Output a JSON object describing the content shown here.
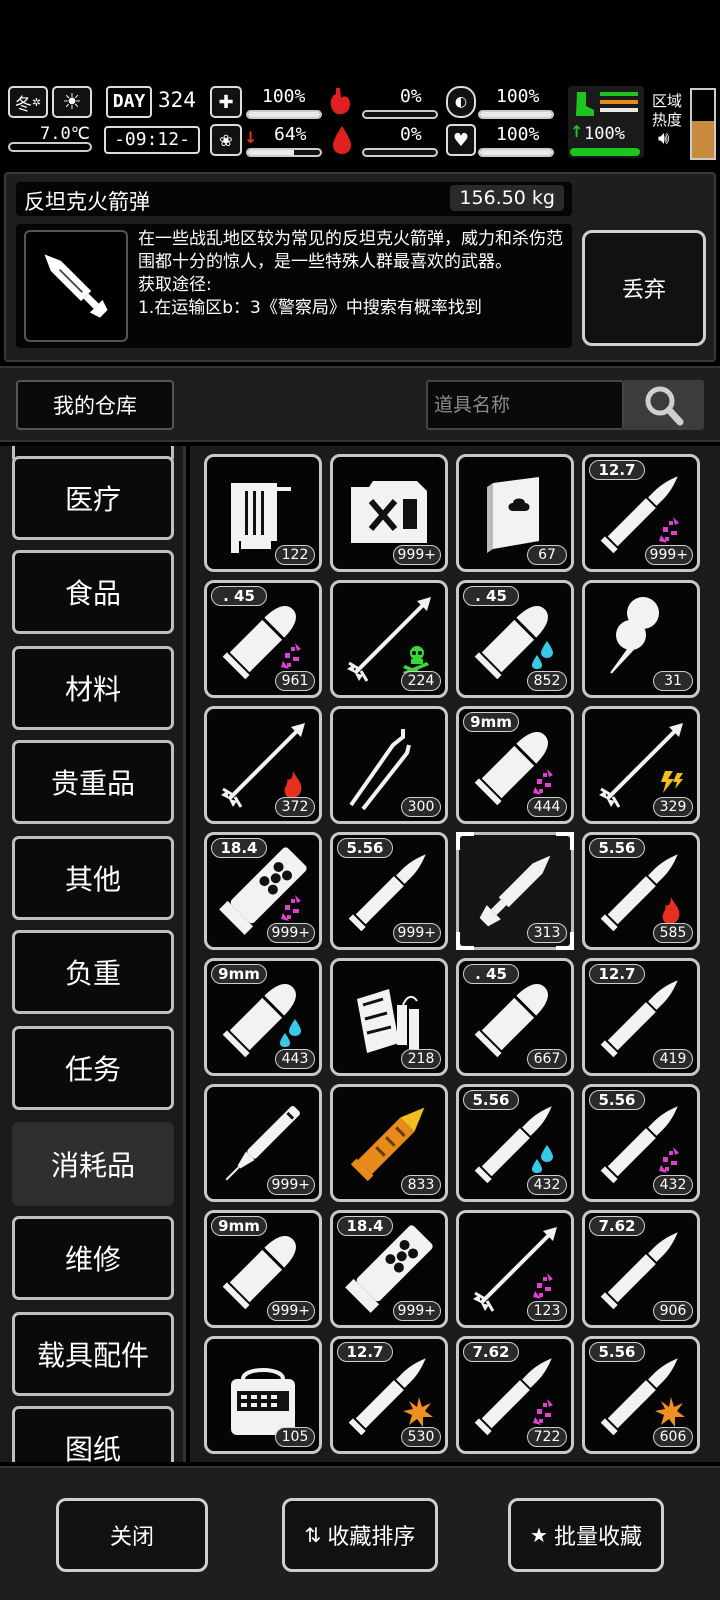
{
  "hud": {
    "season": "冬",
    "temperature": "7.0℃",
    "day_label": "DAY",
    "day_number": "324",
    "time": "-09:12-",
    "stats": [
      {
        "name": "health",
        "value": "100%",
        "fill": 100
      },
      {
        "name": "hunger",
        "value": "0%",
        "fill": 0
      },
      {
        "name": "stamina",
        "value": "100%",
        "fill": 100
      },
      {
        "name": "mental",
        "value": "64%",
        "fill": 64
      },
      {
        "name": "blood",
        "value": "0%",
        "fill": 0
      },
      {
        "name": "heart",
        "value": "100%",
        "fill": 100
      }
    ],
    "weight_pct": "100%",
    "region_label": "区域热度"
  },
  "item_info": {
    "name": "反坦克火箭弹",
    "weight": "156.50 kg",
    "description": "在一些战乱地区较为常见的反坦克火箭弹，威力和杀伤范围都十分的惊人，是一些特殊人群最喜欢的武器。",
    "source_label": "获取途径:",
    "source_partial": "1.在运输区b：3《警察局》中搜索有概率找到",
    "discard_label": "丢弃"
  },
  "warehouse": {
    "title": "我的仓库",
    "search_placeholder": "道具名称"
  },
  "categories": [
    "医疗",
    "食品",
    "材料",
    "贵重品",
    "其他",
    "负重",
    "任务",
    "消耗品",
    "维修",
    "载具配件",
    "图纸"
  ],
  "active_category": "消耗品",
  "items": [
    {
      "icon": "graphics-card-icon",
      "count": "122",
      "caliber": "",
      "effect": ""
    },
    {
      "icon": "fuel-can-icon",
      "count": "999+",
      "caliber": "",
      "effect": ""
    },
    {
      "icon": "book-icon",
      "count": "67",
      "caliber": "",
      "effect": ""
    },
    {
      "icon": "rifle-bullet-icon",
      "count": "999+",
      "caliber": "12.7",
      "effect": "pink-burst"
    },
    {
      "icon": "pistol-bullet-icon",
      "count": "961",
      "caliber": ". 45",
      "effect": "pink-burst"
    },
    {
      "icon": "arrow-icon",
      "count": "224",
      "caliber": "",
      "effect": "poison"
    },
    {
      "icon": "pistol-bullet-icon",
      "count": "852",
      "caliber": ". 45",
      "effect": "water"
    },
    {
      "icon": "balloon-icon",
      "count": "31",
      "caliber": "",
      "effect": ""
    },
    {
      "icon": "arrow-icon",
      "count": "372",
      "caliber": "",
      "effect": "fire"
    },
    {
      "icon": "lockpick-icon",
      "count": "300",
      "caliber": "",
      "effect": ""
    },
    {
      "icon": "pistol-bullet-icon",
      "count": "444",
      "caliber": "9mm",
      "effect": "pink-burst"
    },
    {
      "icon": "arrow-icon",
      "count": "329",
      "caliber": "",
      "effect": "lightning"
    },
    {
      "icon": "shotgun-shell-icon",
      "count": "999+",
      "caliber": "18.4",
      "effect": "pink-burst"
    },
    {
      "icon": "rifle-bullet-icon",
      "count": "999+",
      "caliber": "5.56",
      "effect": ""
    },
    {
      "icon": "rocket-icon",
      "count": "313",
      "caliber": "",
      "effect": ""
    },
    {
      "icon": "rifle-bullet-icon",
      "count": "585",
      "caliber": "5.56",
      "effect": "fire"
    },
    {
      "icon": "pistol-bullet-icon",
      "count": "443",
      "caliber": "9mm",
      "effect": "water"
    },
    {
      "icon": "explosive-pack-icon",
      "count": "218",
      "caliber": "",
      "effect": ""
    },
    {
      "icon": "pistol-bullet-icon",
      "count": "667",
      "caliber": ". 45",
      "effect": ""
    },
    {
      "icon": "rifle-bullet-icon",
      "count": "419",
      "caliber": "12.7",
      "effect": ""
    },
    {
      "icon": "dart-icon",
      "count": "999+",
      "caliber": "",
      "effect": ""
    },
    {
      "icon": "grenade-round-icon",
      "count": "833",
      "caliber": "",
      "effect": ""
    },
    {
      "icon": "rifle-bullet-icon",
      "count": "432",
      "caliber": "5.56",
      "effect": "water"
    },
    {
      "icon": "rifle-bullet-icon",
      "count": "432",
      "caliber": "5.56",
      "effect": "pink-burst"
    },
    {
      "icon": "pistol-bullet-icon",
      "count": "999+",
      "caliber": "9mm",
      "effect": ""
    },
    {
      "icon": "shotgun-shell-icon",
      "count": "999+",
      "caliber": "18.4",
      "effect": ""
    },
    {
      "icon": "arrow-icon",
      "count": "123",
      "caliber": "",
      "effect": "pink-burst"
    },
    {
      "icon": "rifle-bullet-icon",
      "count": "906",
      "caliber": "7.62",
      "effect": ""
    },
    {
      "icon": "radio-device-icon",
      "count": "105",
      "caliber": "",
      "effect": ""
    },
    {
      "icon": "rifle-bullet-icon",
      "count": "530",
      "caliber": "12.7",
      "effect": "explosive"
    },
    {
      "icon": "rifle-bullet-icon",
      "count": "722",
      "caliber": "7.62",
      "effect": "pink-burst"
    },
    {
      "icon": "rifle-bullet-icon",
      "count": "606",
      "caliber": "5.56",
      "effect": "explosive"
    }
  ],
  "selected_item_index": 14,
  "buttons": {
    "close": "关闭",
    "sort_favorites": "收藏排序",
    "batch_favorite": "批量收藏"
  },
  "colors": {
    "pink_effect": "#e040d0",
    "water_effect": "#38c8e8",
    "poison_effect": "#38d838",
    "fire_effect": "#e83020",
    "lightning_effect": "#f0c020",
    "explosive_effect": "#f09020",
    "grenade_orange": "#e88a1a",
    "hud_green": "#1fc51f"
  }
}
